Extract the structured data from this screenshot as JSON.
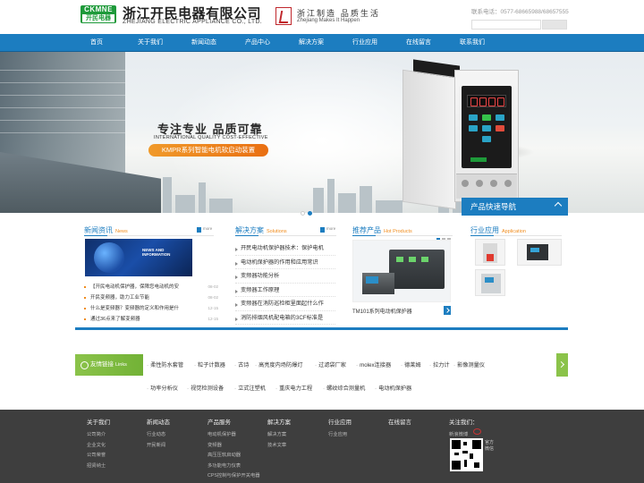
{
  "header": {
    "logo_en": "CKMNE",
    "logo_cn": "开民电器",
    "company_cn": "浙江开民电器有限公司",
    "company_en": "ZHEJIANG ELECTRIC APPLIANCE CO., LTD.",
    "slogan_cn": "浙江制造 品质生活",
    "slogan_en": "Zhejiang Makes It Happen",
    "hotline": "联系电话：0577-68665988/68657555"
  },
  "nav": [
    "首页",
    "关于我们",
    "新闻动态",
    "产品中心",
    "解决方案",
    "行业应用",
    "在线留言",
    "联系我们"
  ],
  "banner": {
    "title": "专注专业  品质可靠",
    "subtitle": "INTERNATIONAL QUALITY COST-EFFECTIVE",
    "pill": "KMPR系列智能电机软启动装置",
    "slides": 2,
    "active_slide": 2
  },
  "quick_nav": {
    "title": "产品快速导航"
  },
  "news": {
    "title": "新闻资讯",
    "title_en": "News",
    "more": "more",
    "image_tag": "NEWS AND INFORMATION",
    "items": [
      {
        "text": "【开民电动机保护器，保障您电动机的安",
        "date": "08-02"
      },
      {
        "text": "开民变频器，助力工业节能",
        "date": "08-02"
      },
      {
        "text": "什么是变频器？变频器的定义和作用是什",
        "date": "12-15"
      },
      {
        "text": "通过36点来了解变频器",
        "date": "12-15"
      }
    ]
  },
  "solutions": {
    "title": "解决方案",
    "title_en": "Solutions",
    "more": "more",
    "items": [
      "开民电动机保护器技术：保护电机",
      "电动机保护器的作用和应用常识",
      "变频器功能分析",
      "变频器工作原理",
      "变频器在消防巡检柜里面起什么作",
      "消防排烟风机配电箱的3CF标准是"
    ]
  },
  "products": {
    "title": "推荐产品",
    "title_en": "Hot Products",
    "caption": "TM101系列电动机保护器"
  },
  "industry": {
    "title": "行业应用",
    "title_en": "Application"
  },
  "links": {
    "title": "友情链接",
    "title_en": "Links",
    "row1": [
      "柔性防水套管",
      "粒子计数器",
      "古诗",
      "高亮度内场防爆灯",
      "过滤袋厂家",
      "molex连接器",
      "德莱姆",
      "拉力计",
      "影像测量仪"
    ],
    "row2": [
      "功率分析仪",
      "视觉检测设备",
      "立式注塑机",
      "重庆电力工程",
      "螺纹综合测量机",
      "电动机保护器"
    ]
  },
  "footer": {
    "cols": [
      {
        "title": "关于我们",
        "items": [
          "公司简介",
          "企业文化",
          "公司荣誉",
          "招贤纳士"
        ]
      },
      {
        "title": "新闻动态",
        "items": [
          "行业动态",
          "开民新闻"
        ]
      },
      {
        "title": "产品服务",
        "items": [
          "电动机保护器",
          "变频器",
          "高压压软启动器",
          "多功能电力仪表",
          "CPS控制与保护开关电器"
        ]
      },
      {
        "title": "解决方案",
        "items": [
          "解决方案",
          "技术文章"
        ]
      },
      {
        "title": "行业应用",
        "items": [
          "行业应用"
        ]
      },
      {
        "title": "在线留言",
        "items": []
      },
      {
        "title": "关注我们：",
        "items": [
          "新浪微博"
        ]
      }
    ],
    "qr_label": "官方微信"
  }
}
